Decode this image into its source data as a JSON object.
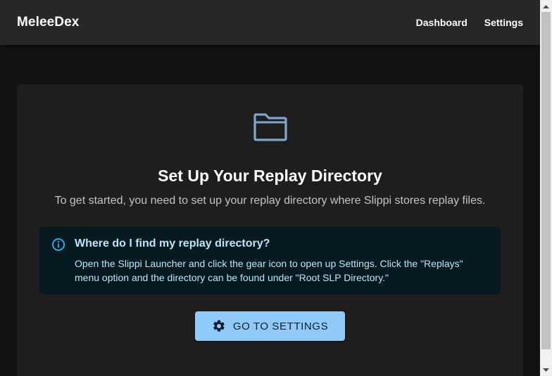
{
  "app": {
    "title": "MeleeDex"
  },
  "nav": {
    "items": [
      {
        "label": "Dashboard"
      },
      {
        "label": "Settings"
      }
    ]
  },
  "setup": {
    "icon": "folder-icon",
    "title": "Set Up Your Replay Directory",
    "subtitle": "To get started, you need to set up your replay directory where Slippi stores replay files."
  },
  "info_alert": {
    "icon": "info-icon",
    "title": "Where do I find my replay directory?",
    "body": "Open the Slippi Launcher and click the gear icon to open up Settings. Click the \"Replays\" menu option and the directory can be found under \"Root SLP Directory.\""
  },
  "action": {
    "icon": "gear-icon",
    "label": "GO TO SETTINGS"
  },
  "colors": {
    "appbar": "#272727",
    "background": "#121212",
    "card": "#1e1e1e",
    "accent": "#90caf9",
    "alert_bg": "#071921",
    "alert_text": "#b8e7fb",
    "folder_icon": "#7fa6cc"
  }
}
